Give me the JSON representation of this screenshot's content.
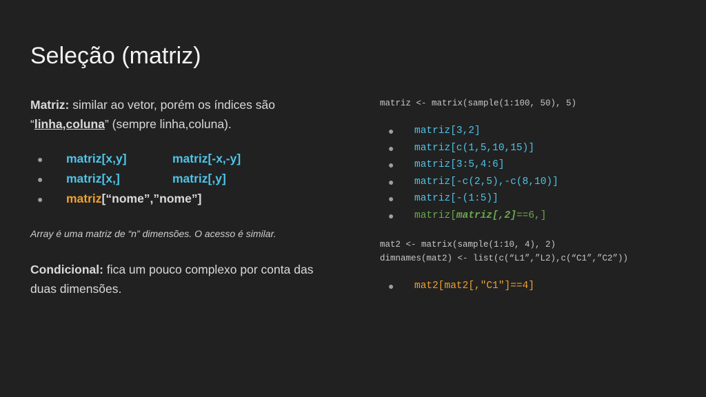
{
  "title": "Seleção (matriz)",
  "matriz_para": {
    "label": "Matriz:",
    "text1": " similar ao vetor, porém os índices são",
    "open_quote": "“",
    "underline": "linha,coluna",
    "text2": "” (sempre linha,coluna)."
  },
  "bullets": [
    {
      "col1": "matriz[x,y]",
      "col2": "matriz[-x,-y]"
    },
    {
      "col1": "matriz[x,]",
      "col2": "matriz[,y]"
    },
    {
      "col1_a": "matriz",
      "col1_b": "[“nome”,”nome”]"
    }
  ],
  "bullet_glyph": "●",
  "note": "Array é uma matriz de “n” dimensões. O acesso é similar.",
  "condicional": {
    "label": "Condicional:",
    "text": " fica um pouco complexo por conta das duas dimensões."
  },
  "code": {
    "line1": "matriz <- matrix(sample(1:100, 50), 5)",
    "items": [
      "matriz[3,2]",
      "matriz[c(1,5,10,15)]",
      "matriz[3:5,4:6]",
      "matriz[-c(2,5),-c(8,10)]",
      "matriz[-(1:5)]"
    ],
    "item6": {
      "a": "matriz[",
      "b": "matriz[,2]",
      "c": "==6,]"
    },
    "mat2_line1": "mat2 <- matrix(sample(1:10, 4), 2)",
    "mat2_line2": "dimnames(mat2) <- list(c(“L1”,”L2),c(“C1”,”C2”))",
    "mat2_item": "mat2[mat2[,\"C1\"]==4]"
  },
  "colors": {
    "background": "#212121",
    "cyan": "#4fc3e6",
    "orange": "#f0a030",
    "green": "#6aa84f"
  }
}
